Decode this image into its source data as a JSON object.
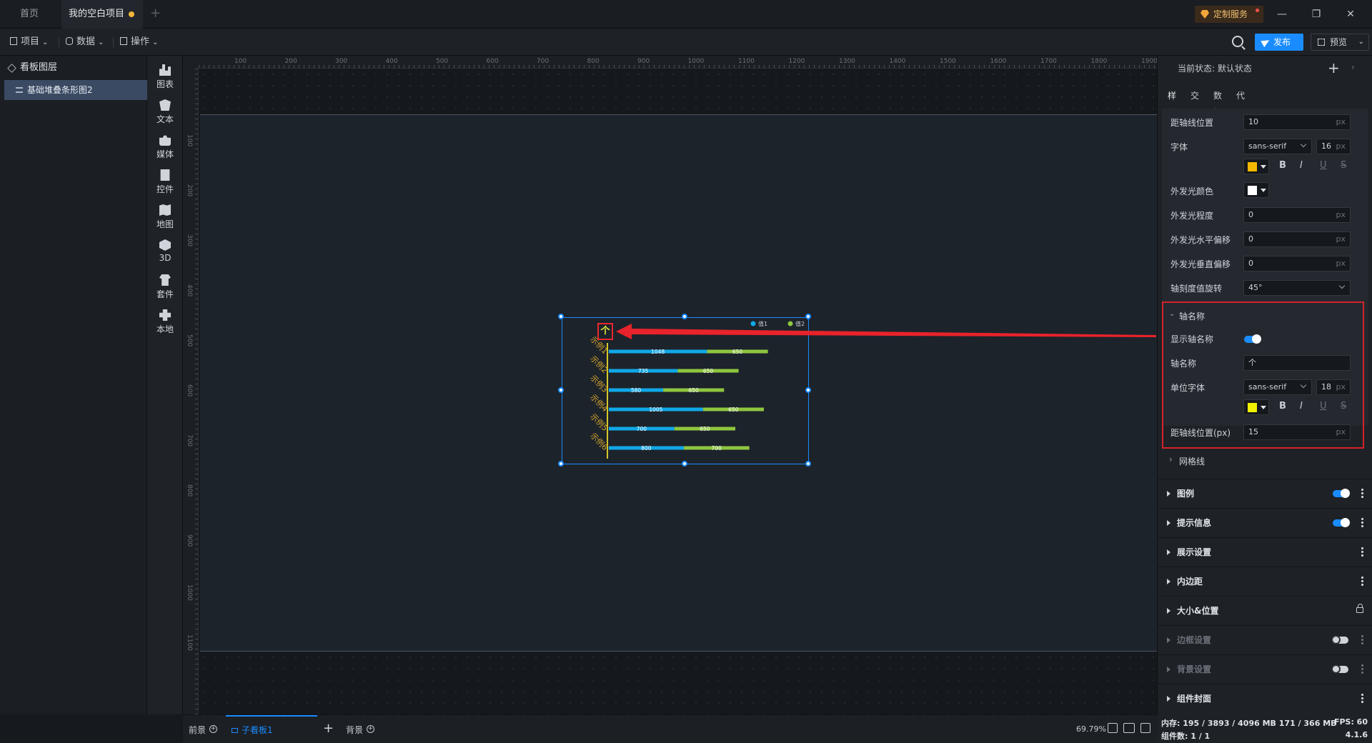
{
  "tabs": {
    "home": "首页",
    "project": "我的空白项目"
  },
  "header": {
    "custom_service": "定制服务"
  },
  "toolbar": {
    "project": "项目",
    "data": "数据",
    "operate": "操作",
    "publish": "发布",
    "preview": "预览"
  },
  "layers": {
    "title": "看板图层",
    "items": [
      "基础堆叠条形图2"
    ]
  },
  "components": [
    "图表",
    "文本",
    "媒体",
    "控件",
    "地图",
    "3D",
    "套件",
    "本地"
  ],
  "ruler": {
    "x": [
      "100",
      "200",
      "300",
      "400",
      "500",
      "600",
      "700",
      "800",
      "900",
      "1000",
      "1100",
      "1200",
      "1300",
      "1400",
      "1500",
      "1600",
      "1700",
      "1800",
      "1900"
    ],
    "y": [
      "100",
      "200",
      "300",
      "400",
      "500",
      "600",
      "700",
      "800",
      "900",
      "1000",
      "1100"
    ]
  },
  "chart_data": {
    "type": "bar",
    "orientation": "horizontal",
    "stacked": true,
    "axis_unit": "个",
    "categories": [
      "示例1",
      "示例2",
      "示例3",
      "示例4",
      "示例5",
      "示例6"
    ],
    "series": [
      {
        "name": "值1",
        "values": [
          1048,
          735,
          580,
          1005,
          700,
          800
        ],
        "color": "#10a8e8"
      },
      {
        "name": "值2",
        "values": [
          650,
          650,
          650,
          650,
          650,
          700
        ],
        "color": "#8ec63f"
      }
    ],
    "xlim": [
      0,
      1800
    ],
    "legend": "top-right",
    "category_label_color": "#d6a82a",
    "grid": false
  },
  "bottom": {
    "foreground": "前景",
    "subboard": "子看板1",
    "background": "背景",
    "zoom": "69.79%"
  },
  "props": {
    "state_label": "当前状态: 默认状态",
    "tabs": [
      "样式",
      "交互",
      "数据",
      "代码"
    ],
    "rows": {
      "axis_line_pos_label": "距轴线位置",
      "axis_line_pos_value": "10",
      "font_label": "字体",
      "font_family": "sans-serif",
      "font_size": "16",
      "glow_color_label": "外发光颜色",
      "glow_level_label": "外发光程度",
      "glow_level_value": "0",
      "glow_h_label": "外发光水平偏移",
      "glow_h_value": "0",
      "glow_v_label": "外发光垂直偏移",
      "glow_v_value": "0",
      "tick_rotate_label": "轴刻度值旋转",
      "tick_rotate_value": "45°"
    },
    "axis_name": {
      "title": "轴名称",
      "show_label": "显示轴名称",
      "name_label": "轴名称",
      "name_value": "个",
      "unit_font_label": "单位字体",
      "unit_font_family": "sans-serif",
      "unit_font_size": "18",
      "dist_label": "距轴线位置(px)",
      "dist_value": "15"
    },
    "gridline": "网格线",
    "unit_px": "px",
    "colors": {
      "font": "#f5b800",
      "glow": "#ffffff",
      "unit_font": "#f0f000"
    },
    "sections": [
      "图例",
      "提示信息",
      "展示设置",
      "内边距",
      "大小&位置",
      "边框设置",
      "背景设置",
      "组件封面"
    ]
  },
  "status": {
    "mem": "内存: 195 / 3893 / 4096 MB  171 / 366 MB",
    "fps": "FPS: 60",
    "count": "组件数: 1 / 1",
    "version": "4.1.6"
  }
}
